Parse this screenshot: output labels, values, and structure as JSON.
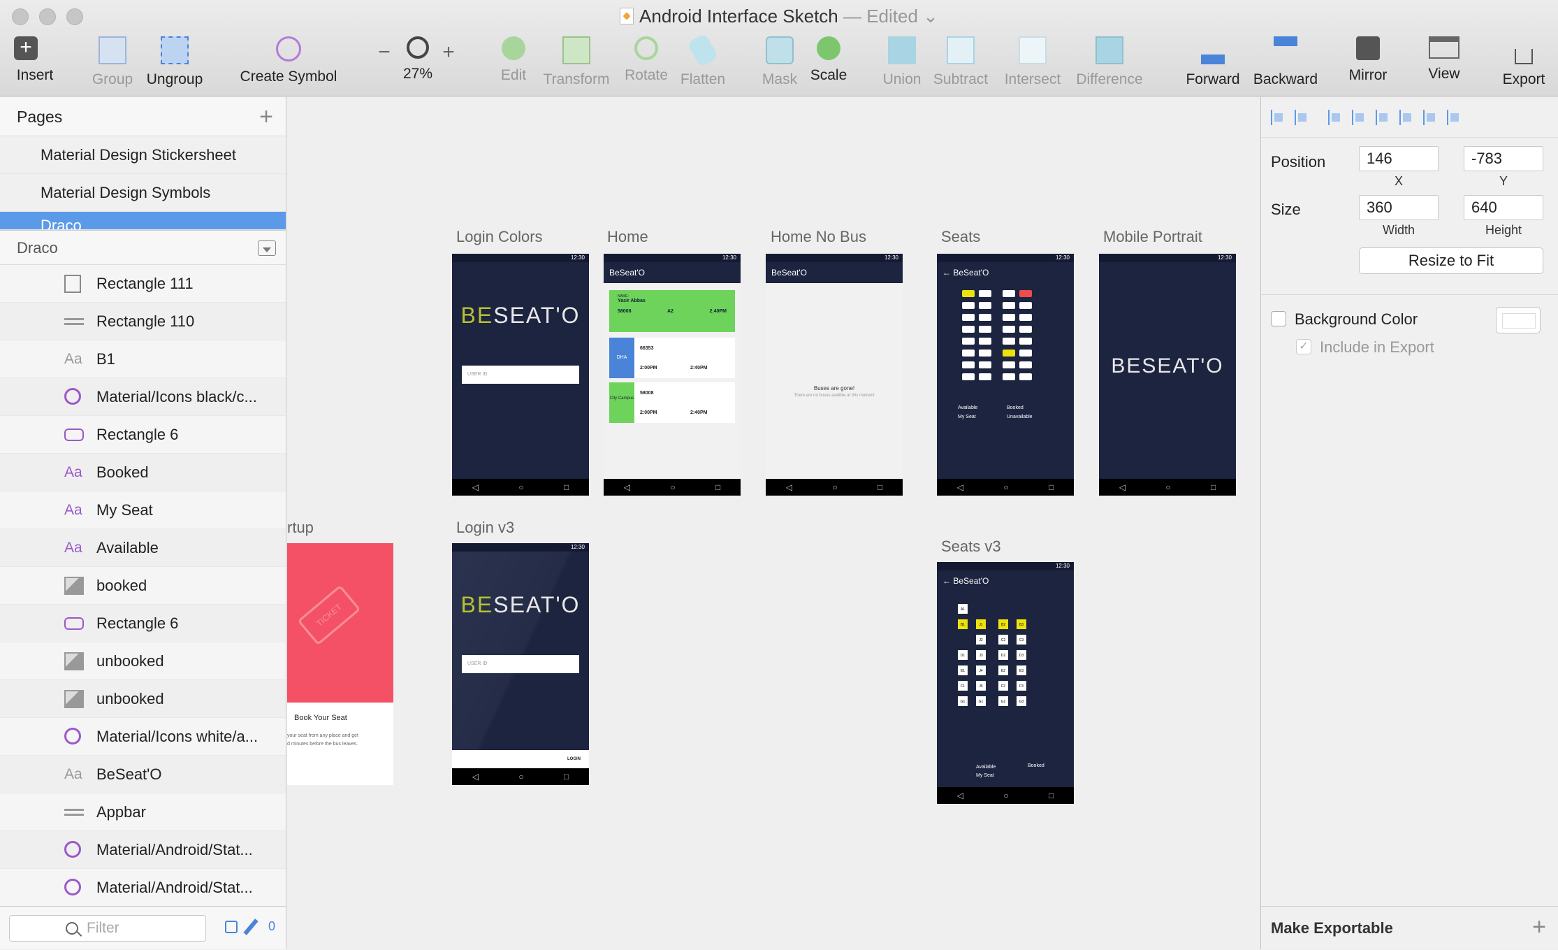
{
  "window": {
    "title": "Android Interface Sketch",
    "status": "— Edited"
  },
  "toolbar": {
    "insert": "Insert",
    "group": "Group",
    "ungroup": "Ungroup",
    "create_symbol": "Create Symbol",
    "zoom": "27%",
    "edit": "Edit",
    "transform": "Transform",
    "rotate": "Rotate",
    "flatten": "Flatten",
    "mask": "Mask",
    "scale": "Scale",
    "union": "Union",
    "subtract": "Subtract",
    "intersect": "Intersect",
    "difference": "Difference",
    "forward": "Forward",
    "backward": "Backward",
    "mirror": "Mirror",
    "view": "View",
    "export": "Export"
  },
  "pages": {
    "header": "Pages",
    "items": [
      "Material Design Stickersheet",
      "Material Design Symbols",
      "Draco"
    ]
  },
  "layers": {
    "header": "Draco",
    "items": [
      {
        "name": "Rectangle 111",
        "icon": "rectangle-icon"
      },
      {
        "name": "Rectangle 110",
        "icon": "line-icon"
      },
      {
        "name": "B1",
        "icon": "text-icon"
      },
      {
        "name": "Material/Icons black/c...",
        "icon": "symbol-icon"
      },
      {
        "name": "Rectangle 6",
        "icon": "rounded-rectangle-icon"
      },
      {
        "name": "Booked",
        "icon": "text-icon"
      },
      {
        "name": "My Seat",
        "icon": "text-icon"
      },
      {
        "name": "Available",
        "icon": "text-icon"
      },
      {
        "name": "booked",
        "icon": "image-icon"
      },
      {
        "name": "Rectangle 6",
        "icon": "rounded-rectangle-icon"
      },
      {
        "name": "unbooked",
        "icon": "image-icon"
      },
      {
        "name": "unbooked",
        "icon": "image-icon"
      },
      {
        "name": "Material/Icons white/a...",
        "icon": "symbol-icon"
      },
      {
        "name": "BeSeat'O",
        "icon": "text-icon"
      },
      {
        "name": "Appbar",
        "icon": "line-icon"
      },
      {
        "name": "Material/Android/Stat...",
        "icon": "symbol-icon"
      },
      {
        "name": "Material/Android/Stat...",
        "icon": "symbol-icon"
      }
    ],
    "filter_placeholder": "Filter",
    "filter_count": "0"
  },
  "artboards": {
    "login_colors": "Login Colors",
    "home": "Home",
    "home_no_bus": "Home No Bus",
    "seats": "Seats",
    "mobile_portrait": "Mobile Portrait",
    "startup": "rtup",
    "login_v3": "Login v3",
    "seats_v3": "Seats v3"
  },
  "screen_text": {
    "logo_be": "BE",
    "logo_rest": "SEAT'O",
    "logo_full": "BESEAT'O",
    "user_id": "USER ID",
    "appbar": "BeSeat'O",
    "status_time": "12:30",
    "name_label": "NAME:",
    "name": "Yasir Abbas",
    "bus_label": "BUS:",
    "seat_label": "SEAT:",
    "departure_label": "DEPARTURE TIME:",
    "arrival_label": "ARRIVAL TIME:",
    "bus1": "58008",
    "seat1": "A2",
    "dep1": "2:40PM",
    "bus2": "66353",
    "place2": "DHA",
    "arr2": "2:00PM",
    "dep2": "2:40PM",
    "bus3": "58008",
    "place3": "City Campus",
    "arr3": "2:00PM",
    "dep3": "2:40PM",
    "gone": "Buses are gone!",
    "gone_sub": "There are no buses availble at this moment",
    "legend_available": "Available",
    "legend_booked": "Booked",
    "legend_myseat": "My Seat",
    "legend_unavailable": "Unavailable",
    "book_title": "Book Your Seat",
    "book_sub1": "your seat from any place and get",
    "book_sub2": "d minutes before the bus leaves.",
    "login_btn": "LOGIN",
    "ticket": "TICKET"
  },
  "inspector": {
    "position_label": "Position",
    "x": "146",
    "y": "-783",
    "x_label": "X",
    "y_label": "Y",
    "size_label": "Size",
    "width": "360",
    "height": "640",
    "width_label": "Width",
    "height_label": "Height",
    "resize": "Resize to Fit",
    "background_color": "Background Color",
    "include_export": "Include in Export",
    "make_exportable": "Make Exportable"
  },
  "colors": {
    "accent": "#5b9ae8",
    "artboard_dark": "#1d2440",
    "green": "#6ed35a",
    "blue": "#4a84d8",
    "yellow": "#ede20e",
    "red": "#ec4d4d",
    "pink": "#f55166"
  }
}
